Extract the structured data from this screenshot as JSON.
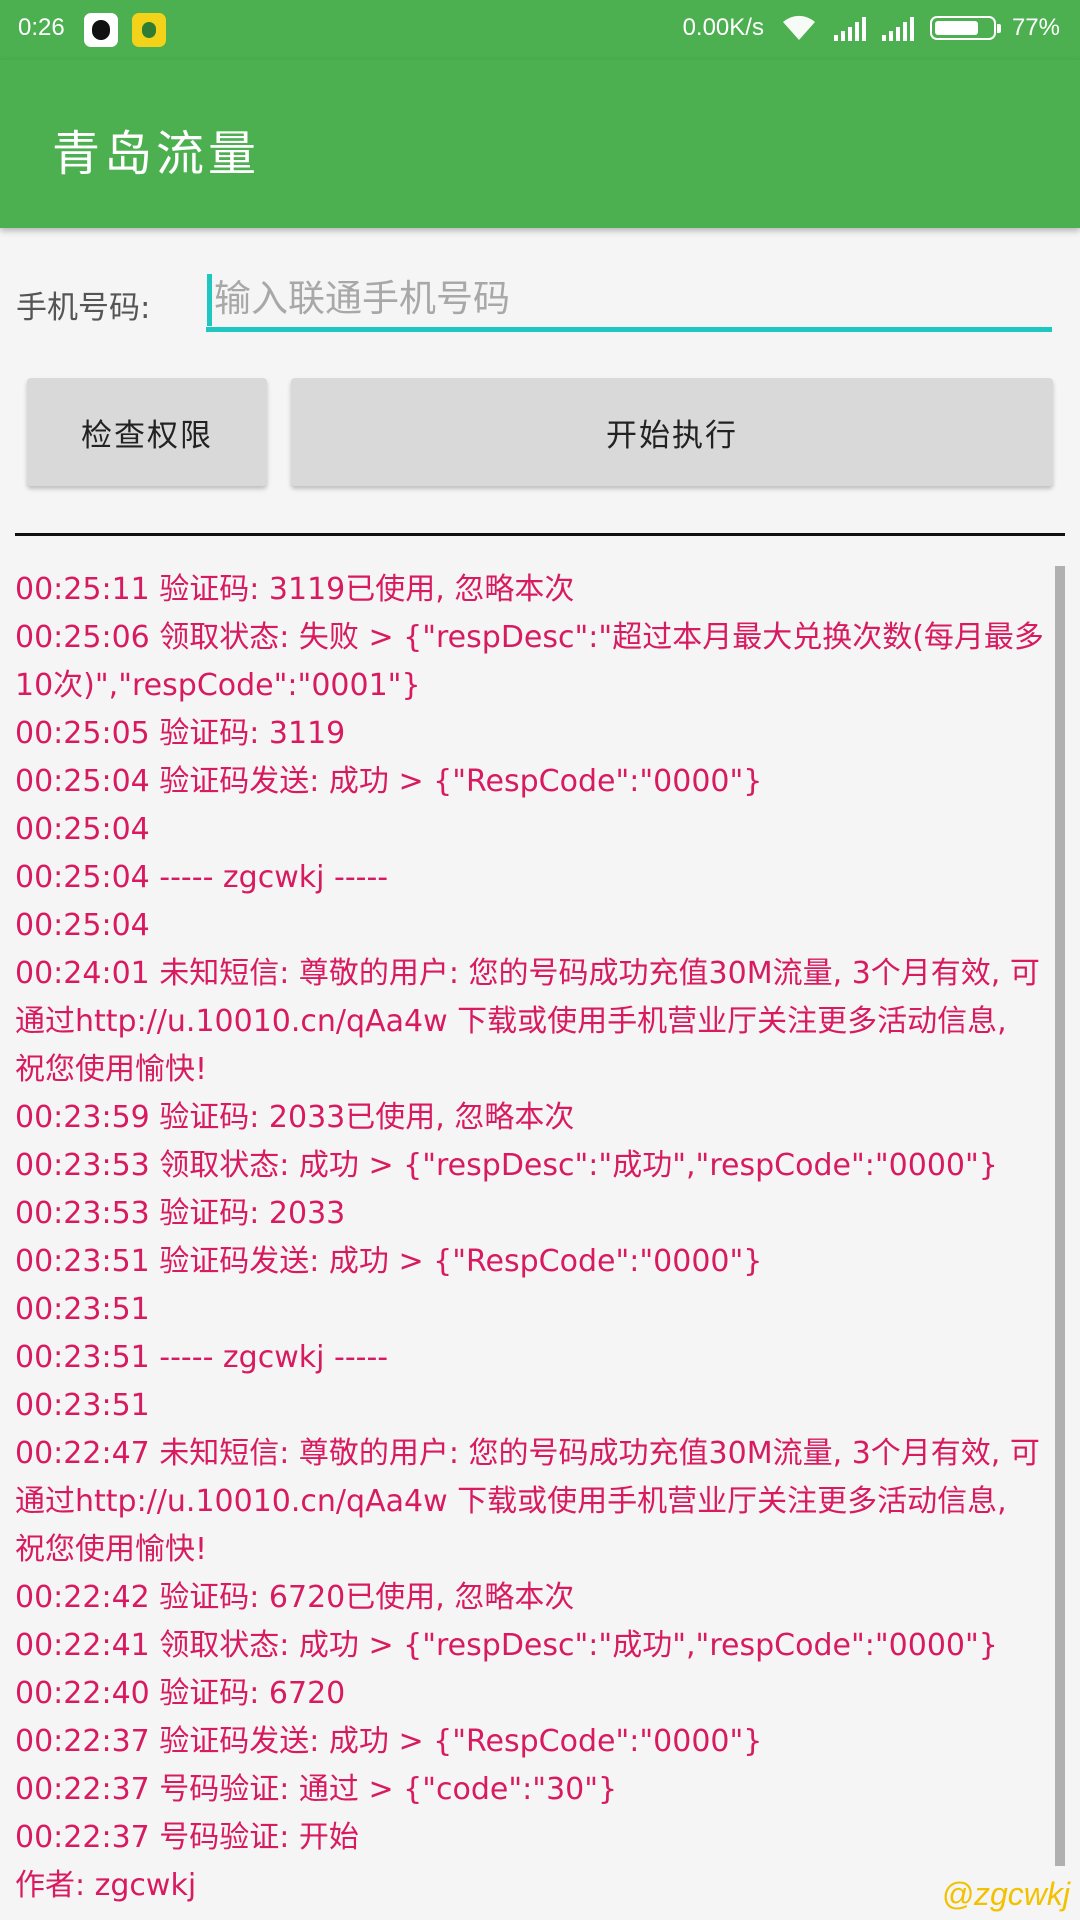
{
  "status_bar": {
    "time": "0:26",
    "net_speed": "0.00K/s",
    "battery_percent": "77%",
    "battery_level": 0.77,
    "icons": [
      "qq-icon",
      "qq-music-icon",
      "wifi-icon",
      "signal-icon",
      "signal-icon",
      "battery-icon"
    ]
  },
  "app_bar": {
    "title": "青岛流量"
  },
  "form": {
    "phone_label": "手机号码:",
    "phone_placeholder": "输入联通手机号码",
    "phone_value": ""
  },
  "buttons": {
    "check_label": "检查权限",
    "start_label": "开始执行"
  },
  "log": [
    "00:25:11 验证码: 3119已使用, 忽略本次",
    "00:25:06 领取状态: 失败 > {\"respDesc\":\"超过本月最大兑换次数(每月最多10次)\",\"respCode\":\"0001\"}",
    "00:25:05 验证码: 3119",
    "00:25:04 验证码发送: 成功 > {\"RespCode\":\"0000\"}",
    "00:25:04",
    "00:25:04 ----- zgcwkj -----",
    "00:25:04",
    "00:24:01 未知短信: 尊敬的用户: 您的号码成功充值30M流量, 3个月有效, 可通过http://u.10010.cn/qAa4w 下载或使用手机营业厅关注更多活动信息, 祝您使用愉快!",
    "00:23:59 验证码: 2033已使用, 忽略本次",
    "00:23:53 领取状态: 成功 > {\"respDesc\":\"成功\",\"respCode\":\"0000\"}",
    "00:23:53 验证码: 2033",
    "00:23:51 验证码发送: 成功 > {\"RespCode\":\"0000\"}",
    "00:23:51",
    "00:23:51 ----- zgcwkj -----",
    "00:23:51",
    "00:22:47 未知短信: 尊敬的用户: 您的号码成功充值30M流量, 3个月有效, 可通过http://u.10010.cn/qAa4w 下载或使用手机营业厅关注更多活动信息, 祝您使用愉快!",
    "00:22:42 验证码: 6720已使用, 忽略本次",
    "00:22:41 领取状态: 成功 > {\"respDesc\":\"成功\",\"respCode\":\"0000\"}",
    "00:22:40 验证码: 6720",
    "00:22:37 验证码发送: 成功 > {\"RespCode\":\"0000\"}",
    "00:22:37 号码验证: 通过 > {\"code\":\"30\"}",
    "00:22:37 号码验证: 开始",
    "作者: zgcwkj"
  ],
  "watermark": "@zgcwkj"
}
